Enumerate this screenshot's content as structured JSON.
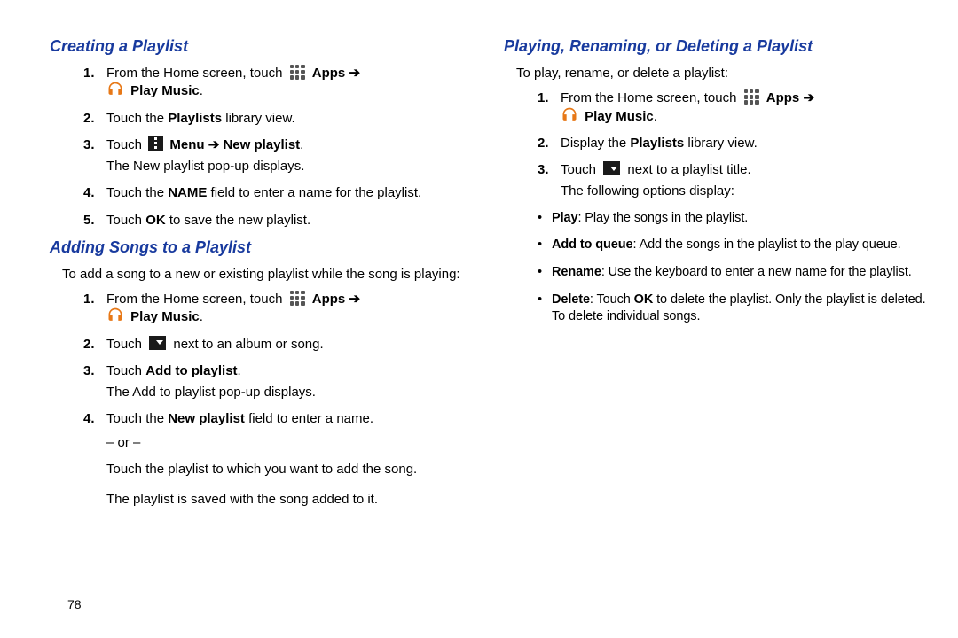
{
  "page_number": "78",
  "arrow": "➔",
  "left": {
    "section1": {
      "heading": "Creating a Playlist",
      "steps": [
        {
          "pre": "From the Home screen, touch ",
          "appsLabel": "Apps",
          "playMusic": "Play Music",
          "post": "."
        },
        {
          "text_a": "Touch the ",
          "bold_a": "Playlists",
          "text_b": " library view."
        },
        {
          "pre": "Touch ",
          "menuLabel": "Menu",
          "newPlaylist": "New playlist",
          "post": ".",
          "extra": "The New playlist pop-up displays."
        },
        {
          "text_a": "Touch the ",
          "bold_a": "NAME",
          "text_b": " field to enter a name for the playlist."
        },
        {
          "text_a": "Touch ",
          "bold_a": "OK",
          "text_b": " to save the new playlist."
        }
      ]
    },
    "section2": {
      "heading": "Adding Songs to a Playlist",
      "intro": "To add a song to a new or existing playlist while the song is playing:",
      "steps": [
        {
          "pre": "From the Home screen, touch ",
          "appsLabel": "Apps",
          "playMusic": "Play Music",
          "post": "."
        },
        {
          "pre": "Touch ",
          "post": " next to an album or song."
        },
        {
          "text_a": "Touch ",
          "bold_a": "Add to playlist",
          "text_b": ".",
          "extra": "The Add to playlist pop-up displays."
        },
        {
          "text_a": "Touch the ",
          "bold_a": "New playlist",
          "text_b": " field to enter a name.",
          "or": "– or –",
          "extra2": "Touch the playlist to which you want to add the song.",
          "extra3": "The playlist is saved with the song added to it."
        }
      ]
    }
  },
  "right": {
    "section1": {
      "heading": "Playing, Renaming, or Deleting a Playlist",
      "intro": "To play, rename, or delete a playlist:",
      "steps": [
        {
          "pre": "From the Home screen, touch ",
          "appsLabel": "Apps",
          "playMusic": "Play Music",
          "post": "."
        },
        {
          "text_a": "Display the ",
          "bold_a": "Playlists",
          "text_b": " library view."
        },
        {
          "pre": "Touch ",
          "post": " next to a playlist title.",
          "extra": "The following options display:"
        }
      ],
      "bullets": [
        {
          "label": "Play",
          "text": ": Play the songs in the playlist."
        },
        {
          "label": "Add to queue",
          "text": ": Add the songs in the playlist to the play queue."
        },
        {
          "label": "Rename",
          "text": ": Use the keyboard to enter a new name for the playlist."
        },
        {
          "label": "Delete",
          "pre": ": Touch ",
          "bold": "OK",
          "text": " to delete the playlist. Only the playlist is deleted. To delete individual songs."
        }
      ]
    }
  }
}
